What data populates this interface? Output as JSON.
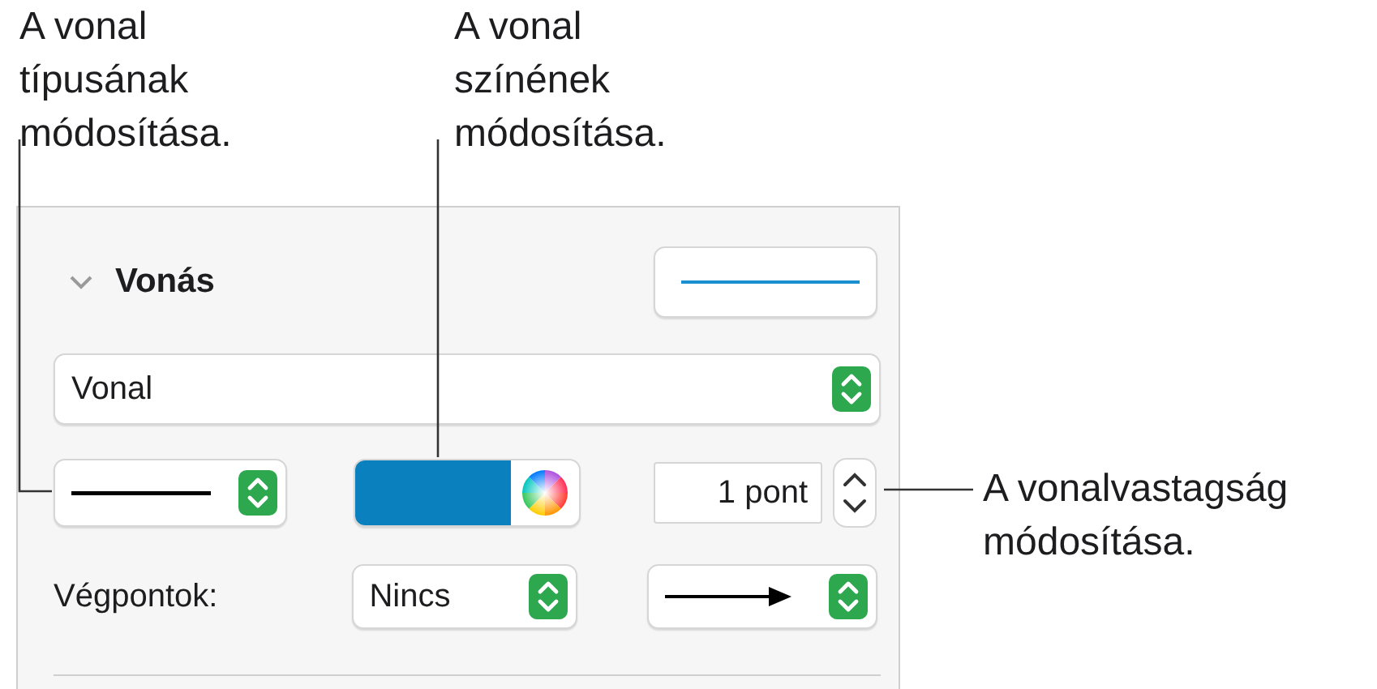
{
  "callouts": [
    {
      "text": "A vonal\ntípusának\nmódosítása."
    },
    {
      "text": "A vonal\nszínének\nmódosítása."
    },
    {
      "text": "A vonalvastagság\nmódosítása."
    }
  ],
  "panel": {
    "section": {
      "title": "Vonás",
      "expanded": true
    },
    "stroke_preview": {
      "color": "#1a8fd0"
    },
    "style_popup": {
      "value": "Vonal"
    },
    "line_popup": {
      "color": "#000000"
    },
    "color_well": {
      "color": "#0b80bf"
    },
    "width_field": {
      "value": "1 pont"
    },
    "endpoints": {
      "label": "Végpontok:",
      "start": "Nincs"
    }
  }
}
